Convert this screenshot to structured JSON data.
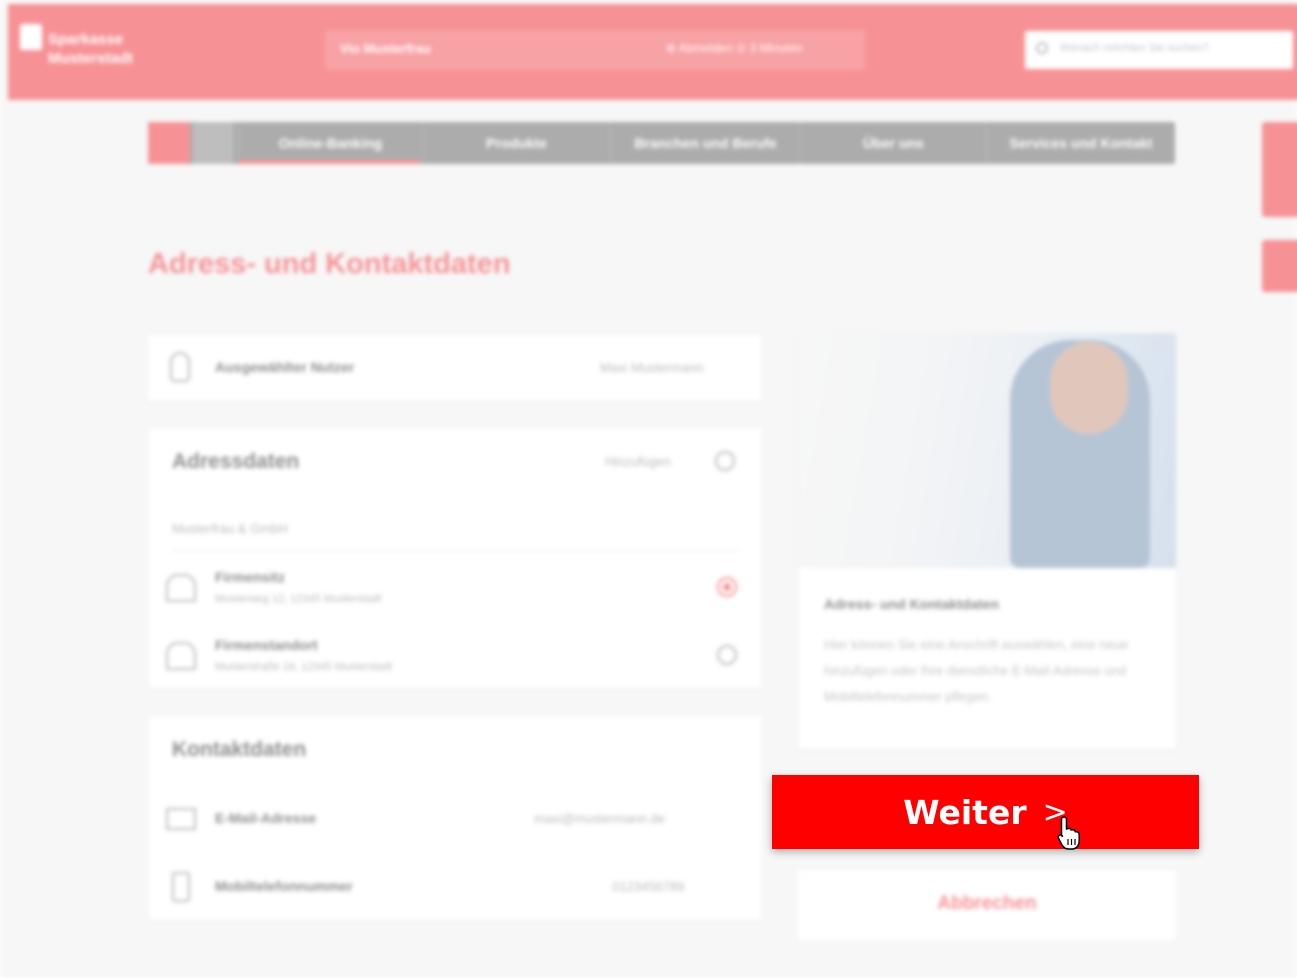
{
  "header": {
    "bank_name": "Sparkasse Musterstadt",
    "user_name": "Vio Musterfrau",
    "session_info": "⊕ Abmelden  ⊙ 3 Minuten",
    "search_placeholder": "Wonach möchten Sie suchen?"
  },
  "nav": {
    "items": [
      "Online-Banking",
      "Produkte",
      "Branchen und Berufe",
      "Über uns",
      "Services und Kontakt"
    ],
    "active": "Online-Banking"
  },
  "page": {
    "title": "Adress- und Kontaktdaten"
  },
  "user_card": {
    "label": "Ausgewählter Nutzer",
    "value": "Maxi Mustermann"
  },
  "address_card": {
    "title": "Adressdaten",
    "add_label": "Hinzufügen",
    "company": "Musterfrau & GmbH",
    "addresses": [
      {
        "label": "Firmensitz",
        "detail": "Musterweg 12, 12345 Musterstadt",
        "selected": true
      },
      {
        "label": "Firmenstandort",
        "detail": "Musterstraße 16, 12345 Musterstadt",
        "selected": false
      }
    ]
  },
  "contact_card": {
    "title": "Kontaktdaten",
    "email_label": "E-Mail-Adresse",
    "email_value": "maxi@mustermann.de",
    "phone_label": "Mobiltelefonnummer",
    "phone_value": "0123456789"
  },
  "info_card": {
    "title": "Adress- und Kontaktdaten",
    "text": "Hier können Sie eine Anschrift auswählen, eine neue hinzufügen oder Ihre dienstliche E-Mail-Adresse und Mobiltelefonnummer pflegen."
  },
  "actions": {
    "continue_label": "Weiter",
    "continue_chevron": ">",
    "cancel_label": "Abbrechen"
  },
  "colors": {
    "brand_red": "#ff0000",
    "accent_red": "#f03a40"
  }
}
